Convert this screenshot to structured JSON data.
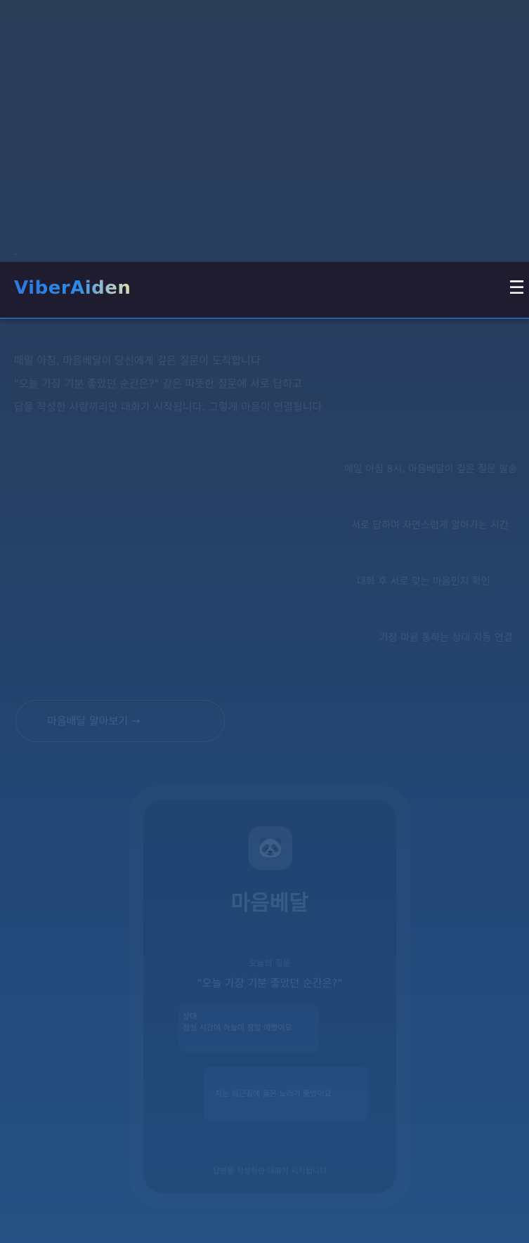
{
  "nav": {
    "logo": "ViberAiden",
    "menu_icon": "☰"
  },
  "colors": {
    "nav_background": "#1e1c2e",
    "nav_border": "#2f5ea8",
    "logo_gradient_start": "#2c7ae0",
    "logo_gradient_end": "#d9dcb2"
  },
  "hero": {
    "description": [
      "매일 아침, 마음베달이 당신에게 깊은 질문이 도착합니다",
      "\"오늘 가장 기분 좋았던 순간은?\" 같은 따뜻한 질문에 서로 답하고",
      "답을 작성한 사람끼리만 대화가 시작됩니다. 그렇게 마음이 연결됩니다"
    ],
    "scrolling_lines": [
      "매일 아침 8시, 마음베달이 깊은 질문 발송",
      "서로 답하며 자연스럽게 알아가는 시간",
      "대화 후 서로 맞는 마음인지 확인",
      "가장 마음 통하는 상대 자동 연결"
    ],
    "cta_label": "마음배달 알아보기 →"
  },
  "phone": {
    "app_icon": "🐼",
    "app_title": "마음베달",
    "question_label": "오늘의 질문",
    "question": "\"오늘 가장 기분 좋았던 순간은?\"",
    "bubble_left_label": "상대",
    "bubble_left_text": "점심 시간에 하늘이 정말 예뻤어요",
    "bubble_right_text": "저는 퇴근길에 들은 노래가 좋았어요",
    "footer": "답변을 작성하면 대화가 시작됩니다"
  }
}
